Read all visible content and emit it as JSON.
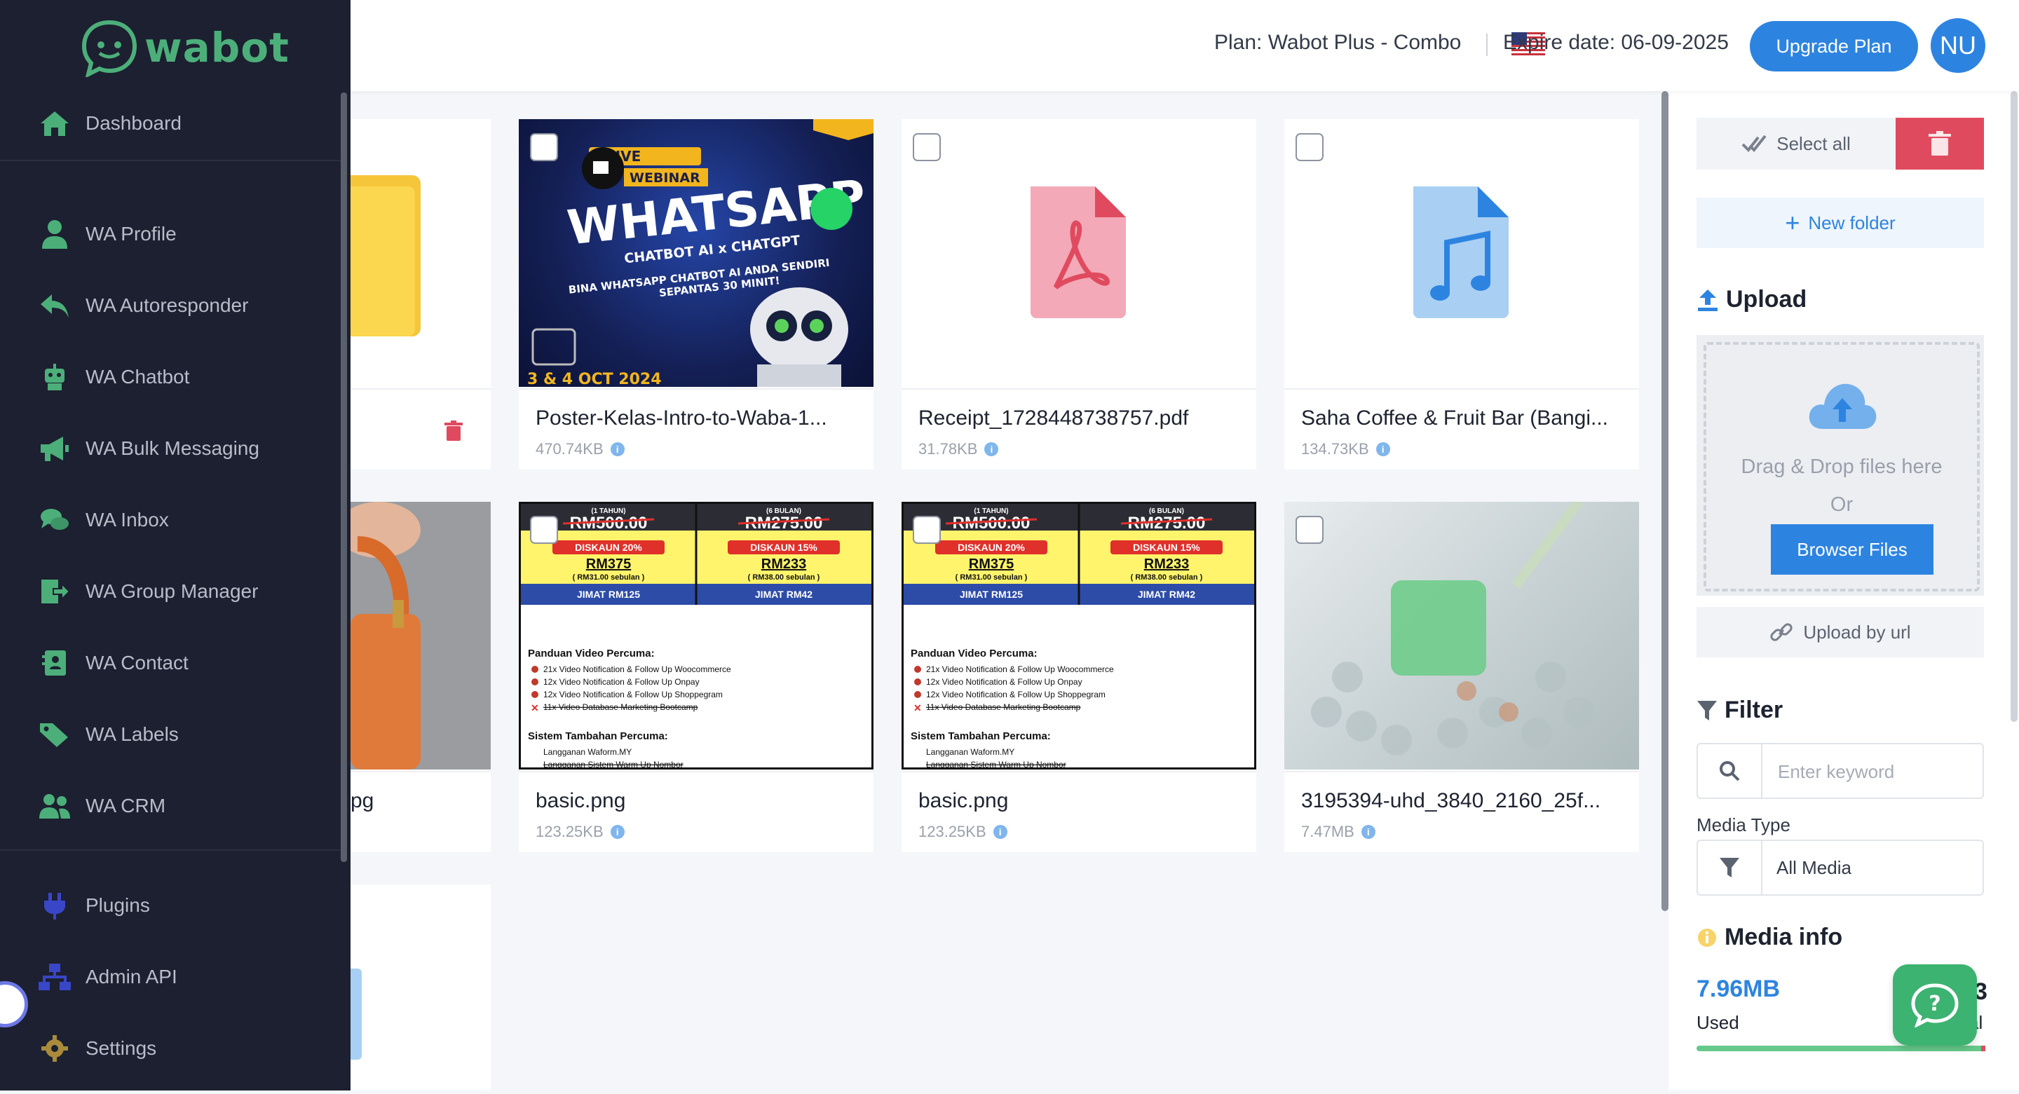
{
  "brand": {
    "name": "wabot"
  },
  "sidebar": {
    "items": [
      {
        "label": "Dashboard",
        "icon": "home-icon"
      },
      {
        "label": "WA Profile",
        "icon": "user-icon"
      },
      {
        "label": "WA Autoresponder",
        "icon": "reply-icon"
      },
      {
        "label": "WA Chatbot",
        "icon": "robot-icon"
      },
      {
        "label": "WA Bulk Messaging",
        "icon": "megaphone-icon"
      },
      {
        "label": "WA Inbox",
        "icon": "chat-bubbles-icon"
      },
      {
        "label": "WA Group Manager",
        "icon": "export-icon"
      },
      {
        "label": "WA Contact",
        "icon": "contact-card-icon"
      },
      {
        "label": "WA Labels",
        "icon": "tags-icon"
      },
      {
        "label": "WA CRM",
        "icon": "users-icon"
      },
      {
        "label": "Plugins",
        "icon": "plug-icon"
      },
      {
        "label": "Admin API",
        "icon": "network-icon"
      },
      {
        "label": "Settings",
        "icon": "gear-icon"
      }
    ]
  },
  "header": {
    "plan": "Plan: Wabot Plus - Combo",
    "expire": "Expire date: 06-09-2025",
    "upgrade_label": "Upgrade Plan",
    "avatar_initials": "NU"
  },
  "files": [
    {
      "name": "Poster-Kelas-Intro-to-Waba-1...",
      "size": "470.74KB"
    },
    {
      "name": "Receipt_1728448738757.pdf",
      "size": "31.78KB"
    },
    {
      "name": "Saha Coffee & Fruit Bar (Bangi...",
      "size": "134.73KB"
    },
    {
      "name": "pg",
      "size": ""
    },
    {
      "name": "basic.png",
      "size": "123.25KB"
    },
    {
      "name": "basic.png",
      "size": "123.25KB"
    },
    {
      "name": "3195394-uhd_3840_2160_25f...",
      "size": "7.47MB"
    }
  ],
  "poster": {
    "badge_top": "LIVE",
    "badge_webinar": "WEBINAR",
    "headline": "WHATSAPP",
    "sub1": "CHATBOT AI x CHATGPT",
    "sub2": "BINA WHATSAPP CHATBOT AI ANDA SENDIRI",
    "sub3": "SEPANTAS 30 MINIT!",
    "date": "3 & 4 OCT 2024"
  },
  "pricing": {
    "col1_period": "(1 TAHUN)",
    "col1_old": "RM500.00",
    "col1_disc": "DISKAUN 20%",
    "col1_price": "RM375",
    "col1_monthly": "( RM31.00 sebulan )",
    "col1_save": "JIMAT RM125",
    "col2_period": "(6 BULAN)",
    "col2_old": "RM275.00",
    "col2_disc": "DISKAUN 15%",
    "col2_price": "RM233",
    "col2_monthly": "( RM38.00 sebulan )",
    "col2_save": "JIMAT RM42",
    "guide_title": "Panduan Video Percuma:",
    "guide1": "21x Video Notification & Follow Up Woocommerce",
    "guide2": "12x Video Notification & Follow Up Onpay",
    "guide3": "12x Video Notification & Follow Up Shoppegram",
    "guide4": "11x Video Database Marketing Bootcamp",
    "extra_title": "Sistem Tambahan Percuma:",
    "extra1": "Langganan Waform.MY",
    "extra2": "Langganan Sistem Warm Up Nombor"
  },
  "right_panel": {
    "select_all": "Select all",
    "new_folder": "New folder",
    "upload_title": "Upload",
    "drag_drop": "Drag & Drop files here",
    "or": "Or",
    "browse": "Browser Files",
    "upload_url": "Upload by url",
    "filter_title": "Filter",
    "keyword_placeholder": "Enter keyword",
    "media_type_label": "Media Type",
    "media_type_value": "All Media",
    "media_info_title": "Media info",
    "used_value": "7.96MB",
    "used_label": "Used",
    "used_fraction": 0.99,
    "peek_right_value": "3",
    "peek_right_label": "al"
  },
  "colors": {
    "sidebar": "#1c2030",
    "accent": "#2d84e0",
    "danger": "#e04a5f",
    "success": "#3cb371"
  }
}
